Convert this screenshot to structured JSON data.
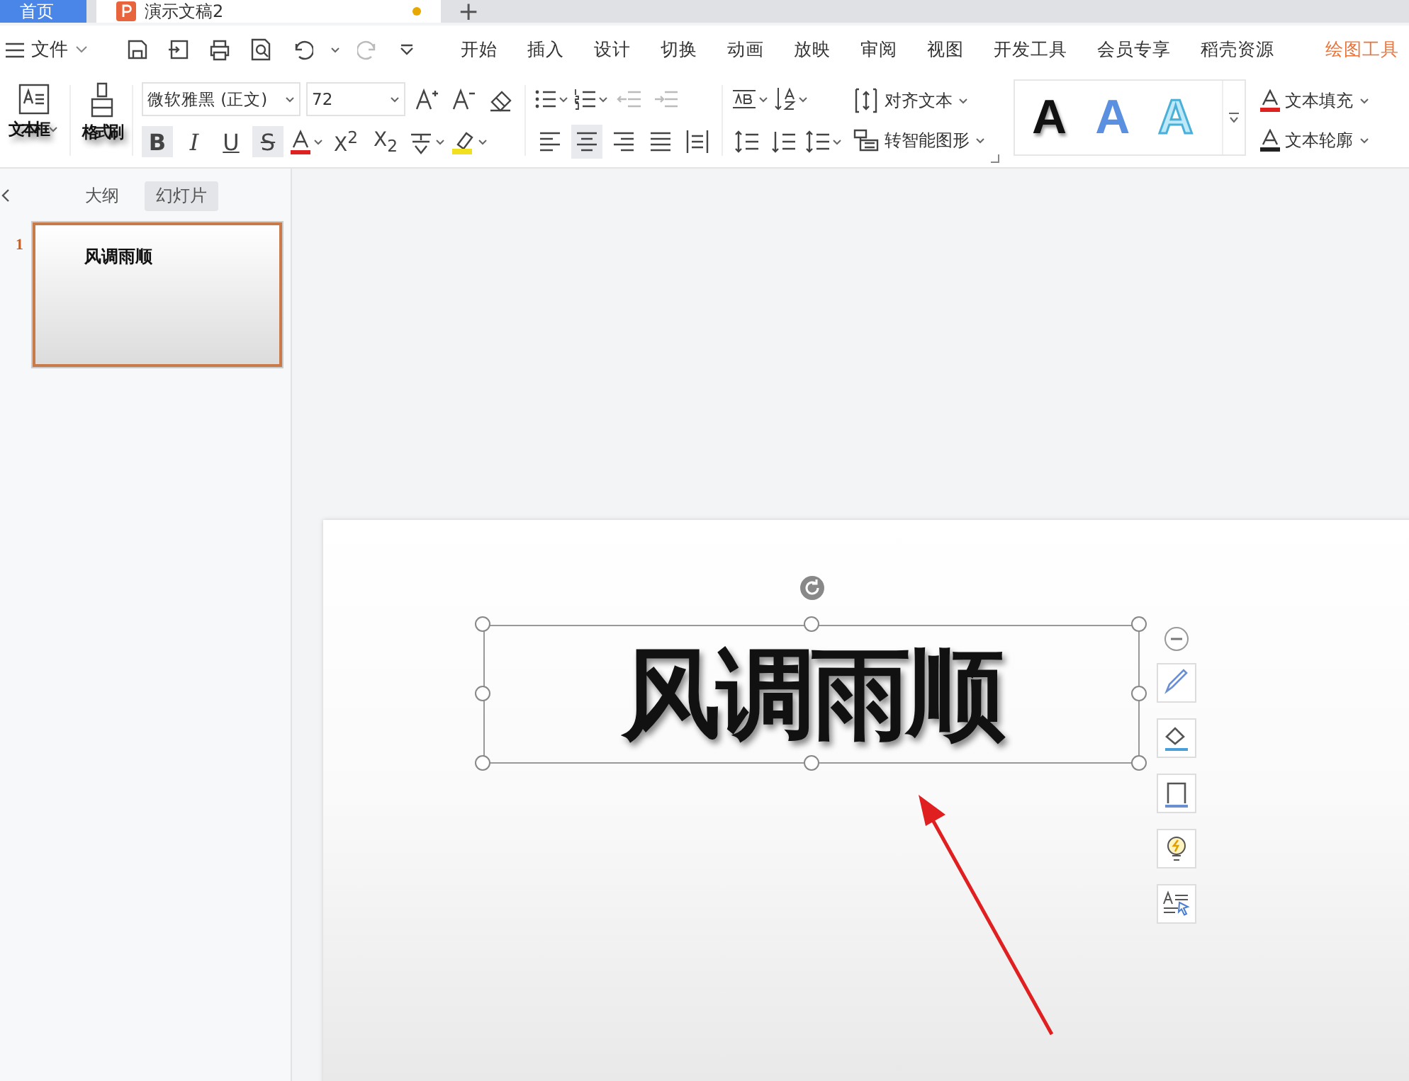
{
  "doc_tabs": [
    {
      "label": "首页",
      "kind": "home",
      "selected": false
    },
    {
      "label": "演示文稿2",
      "kind": "doc",
      "selected": true,
      "modified": true
    }
  ],
  "new_tab": "+",
  "menu": {
    "file": "文件",
    "tabs": [
      {
        "label": "开始",
        "kind": "normal"
      },
      {
        "label": "插入",
        "kind": "normal"
      },
      {
        "label": "设计",
        "kind": "normal"
      },
      {
        "label": "切换",
        "kind": "normal"
      },
      {
        "label": "动画",
        "kind": "normal"
      },
      {
        "label": "放映",
        "kind": "normal"
      },
      {
        "label": "审阅",
        "kind": "normal"
      },
      {
        "label": "视图",
        "kind": "normal"
      },
      {
        "label": "开发工具",
        "kind": "normal"
      },
      {
        "label": "会员专享",
        "kind": "normal"
      },
      {
        "label": "稻壳资源",
        "kind": "normal"
      },
      {
        "label": "绘图工具",
        "kind": "context"
      }
    ]
  },
  "ribbon": {
    "textbox": "文本框",
    "format_painter": "格式刷",
    "font": "微软雅黑 (正文)",
    "font_size": "72",
    "format_buttons": [
      {
        "label": "B",
        "kind": "bold",
        "selected": true
      },
      {
        "label": "I",
        "kind": "italic",
        "selected": false
      },
      {
        "label": "U",
        "kind": "underline",
        "selected": false
      },
      {
        "label": "S",
        "kind": "strike",
        "selected": true
      }
    ],
    "script_buttons": [
      "X$^{2}$",
      "X$_{2}$"
    ],
    "align_buttons": [
      {
        "kind": "left",
        "selected": false
      },
      {
        "kind": "center",
        "selected": true
      },
      {
        "kind": "right",
        "selected": false
      },
      {
        "kind": "justify",
        "selected": false
      },
      {
        "kind": "distribute",
        "selected": false
      }
    ],
    "align_text": "对齐文本",
    "smart_art": "转智能图形",
    "styles": [
      {
        "label": "A",
        "kind": "solid"
      },
      {
        "label": "A",
        "kind": "blue"
      },
      {
        "label": "A",
        "kind": "outline"
      }
    ],
    "text_fill": "文本填充",
    "text_outline": "文本轮廓"
  },
  "panel": {
    "tabs": [
      {
        "label": "大纲",
        "selected": false
      },
      {
        "label": "幻灯片",
        "selected": true
      }
    ],
    "slides": [
      {
        "number": "1",
        "title": "风调雨顺",
        "selected": true
      }
    ]
  },
  "slide": {
    "title": "风调雨顺",
    "selected": true
  }
}
